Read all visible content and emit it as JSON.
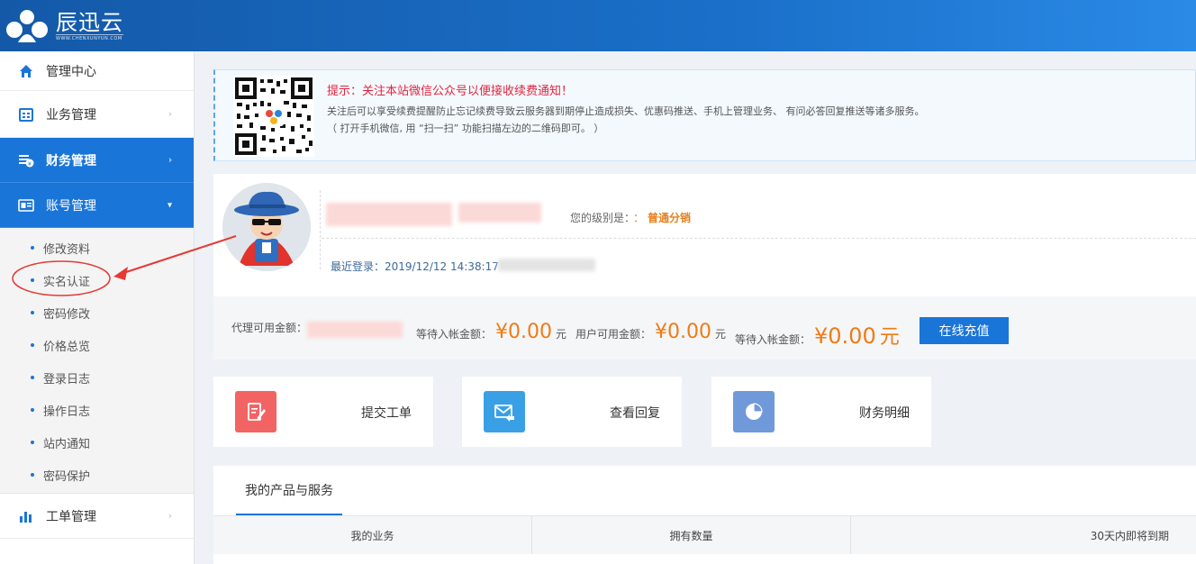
{
  "brand": {
    "name": "辰迅云",
    "domain": "WWW.CHENXUNYUN.COM"
  },
  "sidebar": {
    "items": [
      {
        "label": "管理中心",
        "icon": "home-icon"
      },
      {
        "label": "业务管理",
        "icon": "grid-icon"
      },
      {
        "label": "财务管理",
        "icon": "finance-icon"
      },
      {
        "label": "账号管理",
        "icon": "id-card-icon"
      },
      {
        "label": "工单管理",
        "icon": "bar-chart-icon"
      }
    ],
    "sub_items": [
      "修改资料",
      "实名认证",
      "密码修改",
      "价格总览",
      "登录日志",
      "操作日志",
      "站内通知",
      "密码保护"
    ]
  },
  "notice": {
    "title": "提示：关注本站微信公众号以便接收续费通知！",
    "line1": "关注后可以享受续费提醒防止忘记续费导致云服务器到期停止造成损失、优惠码推送、手机上管理业务、 有问必答回复推送等诸多服务。",
    "line2": "（ 打开手机微信, 用 “扫一扫” 功能扫描左边的二维码即可。 ）"
  },
  "profile": {
    "level_label": "您的级别是：",
    "level_sep": "：",
    "level_value": "普通分销",
    "last_login_label": "最近登录：",
    "last_login_time": "2019/12/12 14:38:17"
  },
  "balance": {
    "agent_label": "代理可用金额：",
    "pending1_label": "等待入帐金额：",
    "pending1_amount": "¥0.00",
    "unit": "元",
    "user_label": "用户可用金额：",
    "user_amount": "¥0.00",
    "pending2_label": "等待入帐金额：",
    "pending2_amount": "¥0.00",
    "recharge_label": "在线充值"
  },
  "quick_actions": [
    {
      "label": "提交工单",
      "icon": "edit-ticket-icon",
      "color": "#f26464"
    },
    {
      "label": "查看回复",
      "icon": "mail-reply-icon",
      "color": "#3aa0e6"
    },
    {
      "label": "财务明细",
      "icon": "pie-chart-icon",
      "color": "#6f99d9"
    }
  ],
  "products": {
    "tab_label": "我的产品与服务",
    "columns": [
      "我的业务",
      "拥有数量",
      "30天内即将到期"
    ]
  },
  "colors": {
    "accent": "#1a75d8",
    "warning": "#e4243e",
    "money": "#f07b14"
  }
}
